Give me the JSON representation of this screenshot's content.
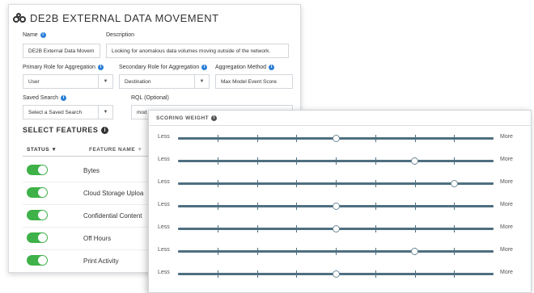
{
  "header": {
    "title": "DE2B EXTERNAL DATA MOVEMENT"
  },
  "form": {
    "name": {
      "label": "Name",
      "value": "DE2B External Data Movem"
    },
    "description": {
      "label": "Description",
      "value": "Looking for anomalous data volumes moving outside of the network."
    },
    "primary_role": {
      "label": "Primary Role for Aggregation",
      "value": "User"
    },
    "secondary_role": {
      "label": "Secondary Role for Aggregation",
      "value": "Destination"
    },
    "aggregation_method": {
      "label": "Aggregation Method",
      "value": "Max Model Event Score"
    },
    "saved_search": {
      "label": "Saved Search",
      "value": "Select a Saved Search"
    },
    "rql": {
      "label": "RQL (Optional)",
      "value": "mod"
    }
  },
  "features": {
    "title": "SELECT FEATURES",
    "col_status": "STATUS",
    "col_feature": "FEATURE NAME",
    "rows": [
      {
        "name": "Bytes",
        "enabled": true
      },
      {
        "name": "Cloud Storage Uploa",
        "enabled": true
      },
      {
        "name": "Confidential Content",
        "enabled": true
      },
      {
        "name": "Off Hours",
        "enabled": true
      },
      {
        "name": "Print Activity",
        "enabled": true
      }
    ]
  },
  "scoring": {
    "title": "SCORING WEIGHT",
    "less_label": "Less",
    "more_label": "More",
    "sliders": [
      0.5,
      0.75,
      0.875,
      0.5,
      0.5,
      0.75,
      0.5
    ]
  },
  "colors": {
    "toggle_on": "#3fb149",
    "info_icon": "#2b7fd6",
    "slider_track": "#4e6f80"
  }
}
